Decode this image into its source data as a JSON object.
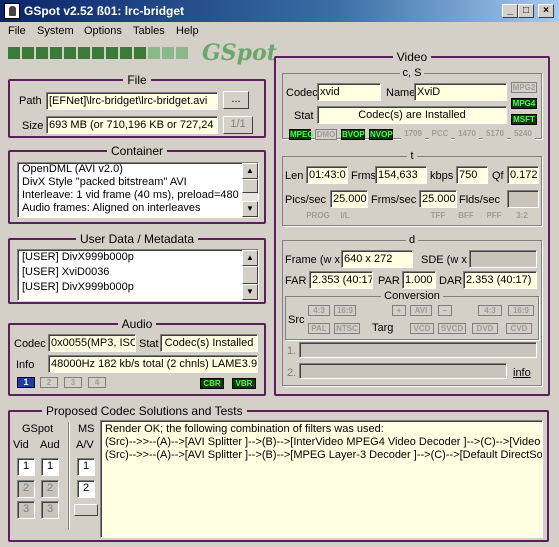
{
  "window": {
    "title": "GSpot v2.52 ß01: lrc-bridget"
  },
  "titlebar_buttons": [
    "_",
    "□",
    "×"
  ],
  "menu": [
    "File",
    "System",
    "Options",
    "Tables",
    "Help"
  ],
  "logo": "GSpot",
  "file": {
    "title": "File",
    "path_label": "Path",
    "path_value": "[EFNet]\\lrc-bridget\\lrc-bridget.avi",
    "browse_label": "...",
    "size_label": "Size",
    "size_value": "693 MB (or 710,196 KB or 727,24",
    "page_label": "1/1"
  },
  "container": {
    "title": "Container",
    "lines": [
      "OpenDML (AVI v2.0)",
      "DivX Style \"packed bitstream\" AVI",
      "Interleave: 1 vid frame (40 ms), preload=480",
      "Audio frames: Aligned on interleaves"
    ]
  },
  "userdata": {
    "title": "User Data / Metadata",
    "lines": [
      "[USER]     DivX999b000p",
      "[USER]     XviD0036",
      "[USER]     DivX999b000p"
    ]
  },
  "audio": {
    "title": "Audio",
    "codec_label": "Codec",
    "codec_value": "0x0055(MP3, ISO",
    "stat_label": "Stat",
    "stat_value": "Codec(s) Installed",
    "info_label": "Info",
    "info_value": "48000Hz  182 kb/s total (2 chnls) LAME3.9",
    "streams": [
      "1",
      "2",
      "3",
      "4"
    ],
    "leds": [
      "CBR",
      "VBR"
    ]
  },
  "video": {
    "title": "Video",
    "cs_title": "c, S",
    "codec_label": "Codec",
    "codec_value": "xvid",
    "name_label": "Name",
    "name_value": "XviD",
    "stat_label": "Stat",
    "stat_value": "Codec(s) are Installed",
    "side_leds": [
      "MPG2",
      "MPG4",
      "MSFT"
    ],
    "std_leds": [
      "MPEG",
      "DMO",
      "BVOP",
      "NVOP",
      "1709",
      "PCC",
      "1470",
      "5170",
      "5240"
    ],
    "t_title": "t",
    "len_label": "Len",
    "len_value": "01:43:0",
    "frms_label": "Frms",
    "frms_value": "154,633",
    "kbps_label": "kbps",
    "kbps_value": "750",
    "qf_label": "Qf",
    "qf_value": "0.172",
    "pics_label": "Pics/sec",
    "pics_value": "25.000",
    "fms_label": "Frms/sec",
    "fms_value": "25.000",
    "flds_label": "Flds/sec",
    "t_leds": [
      "PROG",
      "I/L",
      "TFF",
      "BFF",
      "PFF",
      "3:2"
    ],
    "d_title": "d",
    "frame_label": "Frame (w x",
    "frame_value": "640 x 272",
    "sde_label": "SDE (w x",
    "far_label": "FAR",
    "far_value": "2.353 (40:17",
    "par_label": "PAR",
    "par_value": "1.000",
    "dar_label": "DAR",
    "dar_value": "2.353 (40:17)",
    "conv_title": "Conversion",
    "src_label": "Src",
    "targ_label": "Targ",
    "src_ratio": [
      "4:3",
      "16:9"
    ],
    "src_std": [
      "PAL",
      "NTSC"
    ],
    "conv_btns": [
      "+",
      "AVI",
      "–",
      "4:3",
      "16:9"
    ],
    "targ_btns": [
      "VCD",
      "SVCD",
      "DVD",
      "CVD"
    ],
    "row1": "1.",
    "row2": "2.",
    "info_link": "info"
  },
  "proposed": {
    "title": "Proposed Codec Solutions and Tests",
    "gspot_label": "GSpot",
    "vid_label": "Vid",
    "aud_label": "Aud",
    "ms_label": "MS",
    "av_label": "A/V",
    "nums": [
      "1",
      "2",
      "3"
    ],
    "lines": [
      "Render OK; the following combination of filters was used:",
      "(Src)-->>--(A)-->[AVI Splitter ]-->(B)-->[InterVideo MPEG4 Video Decoder ]-->(C)-->[Video Rend",
      "(Src)-->>--(A)-->[AVI Splitter ]-->(B)-->[MPEG Layer-3 Decoder ]-->(C)-->[Default DirectSound D"
    ]
  }
}
